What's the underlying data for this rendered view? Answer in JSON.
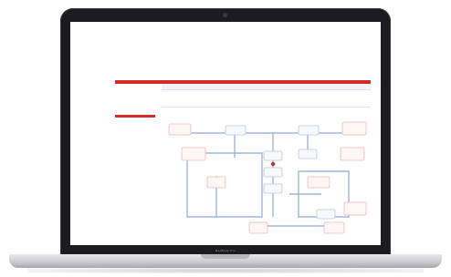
{
  "device": {
    "brand": "MacBook Pro"
  },
  "app": {
    "title": "",
    "subtitle": "",
    "nav": [],
    "top_right": "",
    "side_items": [],
    "footer_text": "",
    "footer_brand": ""
  },
  "table": {
    "headers": [],
    "tabs": []
  },
  "diagram": {
    "nodes": [],
    "colors": {
      "node_border": "#f1b8b8",
      "node_fill": "#fff6f6",
      "connector": "#9fb6d8",
      "accent": "#d62b2b"
    }
  }
}
